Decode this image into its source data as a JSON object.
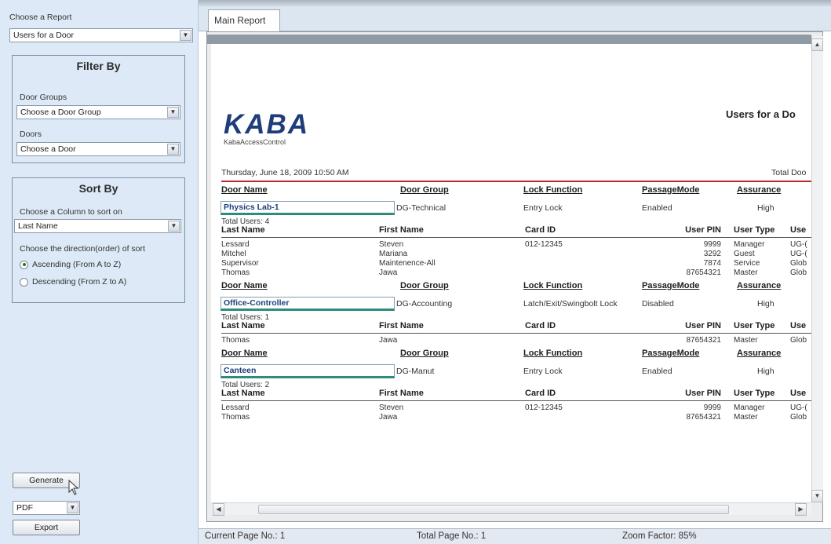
{
  "left": {
    "choose_report_label": "Choose a Report",
    "report_value": "Users for a Door",
    "filter_title": "Filter By",
    "door_groups_label": "Door Groups",
    "door_group_value": "Choose a Door Group",
    "doors_label": "Doors",
    "door_value": "Choose a Door",
    "sort_title": "Sort By",
    "sort_column_label": "Choose a Column to sort on",
    "sort_column_value": "Last Name",
    "direction_label": "Choose the direction(order) of sort",
    "ascending_label": "Ascending (From A to Z)",
    "descending_label": "Descending (From Z to A)",
    "generate_label": "Generate",
    "format_value": "PDF",
    "export_label": "Export"
  },
  "tab": {
    "main_label": "Main Report"
  },
  "report": {
    "logo_text": "KABA",
    "logo_sub": "KabaAccessControl",
    "title": "Users for a Do",
    "date": "Thursday, June 18, 2009 10:50 AM",
    "total_doors_label": "Total Doo",
    "door_headers": [
      "Door Name",
      "Door Group",
      "Lock Function",
      "PassageMode",
      "Assurance"
    ],
    "user_headers": [
      "Last Name",
      "First Name",
      "Card ID",
      "User PIN",
      "User Type",
      "Use"
    ],
    "doors": [
      {
        "name": "Physics Lab-1",
        "group": "DG-Technical",
        "lock": "Entry Lock",
        "passage": "Enabled",
        "assurance": "High",
        "total_users": "Total Users:   4",
        "users": [
          {
            "last": "Lessard",
            "first": "Steven",
            "card": "012-12345",
            "pin": "9999",
            "type": "Manager",
            "use": "UG-("
          },
          {
            "last": "Mitchel",
            "first": "Mariana",
            "card": "",
            "pin": "3292",
            "type": "Guest",
            "use": "UG-("
          },
          {
            "last": "Supervisor",
            "first": "Maintenence-All",
            "card": "",
            "pin": "7874",
            "type": "Service",
            "use": "Glob"
          },
          {
            "last": "Thomas",
            "first": "Jawa",
            "card": "",
            "pin": "87654321",
            "type": "Master",
            "use": "Glob"
          }
        ]
      },
      {
        "name": "Office-Controller",
        "group": "DG-Accounting",
        "lock": "Latch/Exit/Swingbolt Lock",
        "passage": "Disabled",
        "assurance": "High",
        "total_users": "Total Users:   1",
        "users": [
          {
            "last": "Thomas",
            "first": "Jawa",
            "card": "",
            "pin": "87654321",
            "type": "Master",
            "use": "Glob"
          }
        ]
      },
      {
        "name": "Canteen",
        "group": "DG-Manut",
        "lock": "Entry Lock",
        "passage": "Enabled",
        "assurance": "High",
        "total_users": "Total Users:   2",
        "users": [
          {
            "last": "Lessard",
            "first": "Steven",
            "card": "012-12345",
            "pin": "9999",
            "type": "Manager",
            "use": "UG-("
          },
          {
            "last": "Thomas",
            "first": "Jawa",
            "card": "",
            "pin": "87654321",
            "type": "Master",
            "use": "Glob"
          }
        ]
      }
    ]
  },
  "status": {
    "current_page": "Current Page No.: 1",
    "total_page": "Total Page No.: 1",
    "zoom": "Zoom Factor: 85%"
  },
  "colors": {
    "panel_bg": "#dde9f6",
    "title_rule": "#c0272d",
    "logo": "#1f3d7a",
    "name_box_accent": "#2d8c7e"
  }
}
